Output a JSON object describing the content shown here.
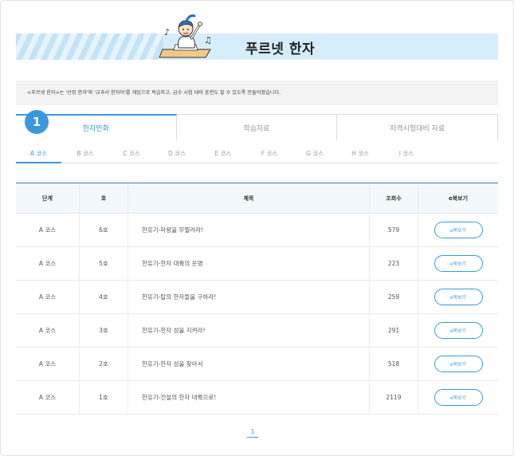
{
  "banner": {
    "title": "푸르넷 한자"
  },
  "intro": {
    "text": "<푸르넷 한자>는 '선정 한자'와 '교과서 한자어'를 게임으로 복습하고, 급수 시험 대비 훈련도 할 수 있도록 만들어졌습니다."
  },
  "step_badge": "1",
  "main_tabs": [
    {
      "label": "한자만화",
      "active": true
    },
    {
      "label": "학습자료",
      "active": false
    },
    {
      "label": "자격시험대비 자료",
      "active": false
    }
  ],
  "sub_tabs": [
    {
      "label": "A 코스",
      "active": true
    },
    {
      "label": "B 코스",
      "active": false
    },
    {
      "label": "C 코스",
      "active": false
    },
    {
      "label": "D 코스",
      "active": false
    },
    {
      "label": "E 코스",
      "active": false
    },
    {
      "label": "F 코스",
      "active": false
    },
    {
      "label": "G 코스",
      "active": false
    },
    {
      "label": "H 코스",
      "active": false
    },
    {
      "label": "I 코스",
      "active": false
    }
  ],
  "table": {
    "headers": [
      "단계",
      "호",
      "제목",
      "조회수",
      "e북보기"
    ],
    "rows": [
      {
        "stage": "A 코스",
        "issue": "6호",
        "title": "한유기-마왕을 무찔러라!",
        "views": "579",
        "button": "e북보기"
      },
      {
        "stage": "A 코스",
        "issue": "5호",
        "title": "한유기-한자 대륙의 운명",
        "views": "223",
        "button": "e북보기"
      },
      {
        "stage": "A 코스",
        "issue": "4호",
        "title": "한유기-탑의 한자들을 구하라!",
        "views": "259",
        "button": "e북보기"
      },
      {
        "stage": "A 코스",
        "issue": "3호",
        "title": "한유기-한자 성을 지켜라!",
        "views": "291",
        "button": "e북보기"
      },
      {
        "stage": "A 코스",
        "issue": "2호",
        "title": "한유기-한자 성을 찾아서",
        "views": "518",
        "button": "e북보기"
      },
      {
        "stage": "A 코스",
        "issue": "1호",
        "title": "한유기-전설의 한자 대륙으로!",
        "views": "2119",
        "button": "e북보기"
      }
    ]
  },
  "pagination": {
    "current": "1"
  },
  "colors": {
    "accent": "#3a98de",
    "banner_bg": "#d6eefb",
    "header_line": "#3a7fc1"
  }
}
